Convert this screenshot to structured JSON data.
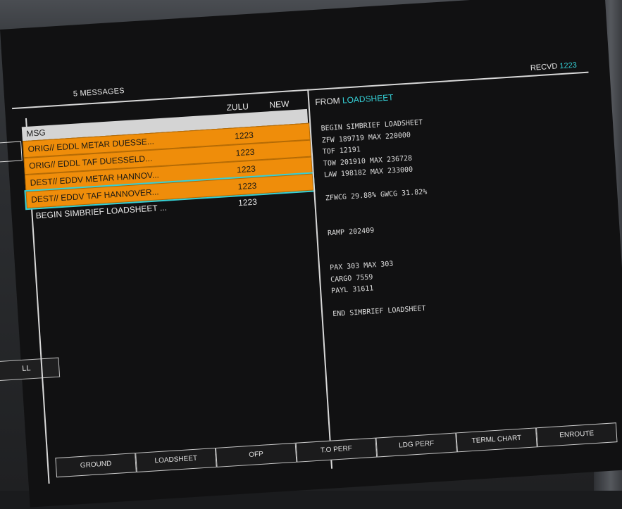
{
  "bezel": {
    "buttons": [
      "▼✱",
      "✱▲",
      "▼◐",
      "◐▲"
    ]
  },
  "header": {
    "message_count": "5 MESSAGES",
    "col_zulu": "ZULU",
    "col_new": "NEW",
    "recvd_label": "RECVD",
    "recvd_time": "1223"
  },
  "list": {
    "header_label": "MSG",
    "rows": [
      {
        "subject": "ORIG// EDDL METAR DUESSE...",
        "time": "1223"
      },
      {
        "subject": "ORIG// EDDL TAF DUESSELD...",
        "time": "1223"
      },
      {
        "subject": "DEST// EDDV METAR HANNOV...",
        "time": "1223"
      },
      {
        "subject": "DEST// EDDV TAF HANNOVER...",
        "time": "1223"
      },
      {
        "subject": "BEGIN SIMBRIEF LOADSHEET ...",
        "time": "1223"
      }
    ]
  },
  "left_panel": {
    "button_label": "LL"
  },
  "message": {
    "from_label": "FROM",
    "from_source": "LOADSHEET",
    "body": "BEGIN SIMBRIEF LOADSHEET\nZFW 189719 MAX 220000\nTOF 12191\nTOW 201910 MAX 236728\nLAW 198182 MAX 233000\n\nZFWCG 29.88% GWCG 31.82%\n\n\nRAMP 202409\n\n\nPAX 303 MAX 303\nCARGO 7559\nPAYL 31611\n\nEND SIMBRIEF LOADSHEET"
  },
  "tabs": [
    "GROUND",
    "LOADSHEET",
    "OFP",
    "T.O PERF",
    "LDG PERF",
    "TERML CHART",
    "ENROUTE"
  ],
  "colors": {
    "accent_cyan": "#35d0d6",
    "unread_orange": "#ef8d0a"
  }
}
